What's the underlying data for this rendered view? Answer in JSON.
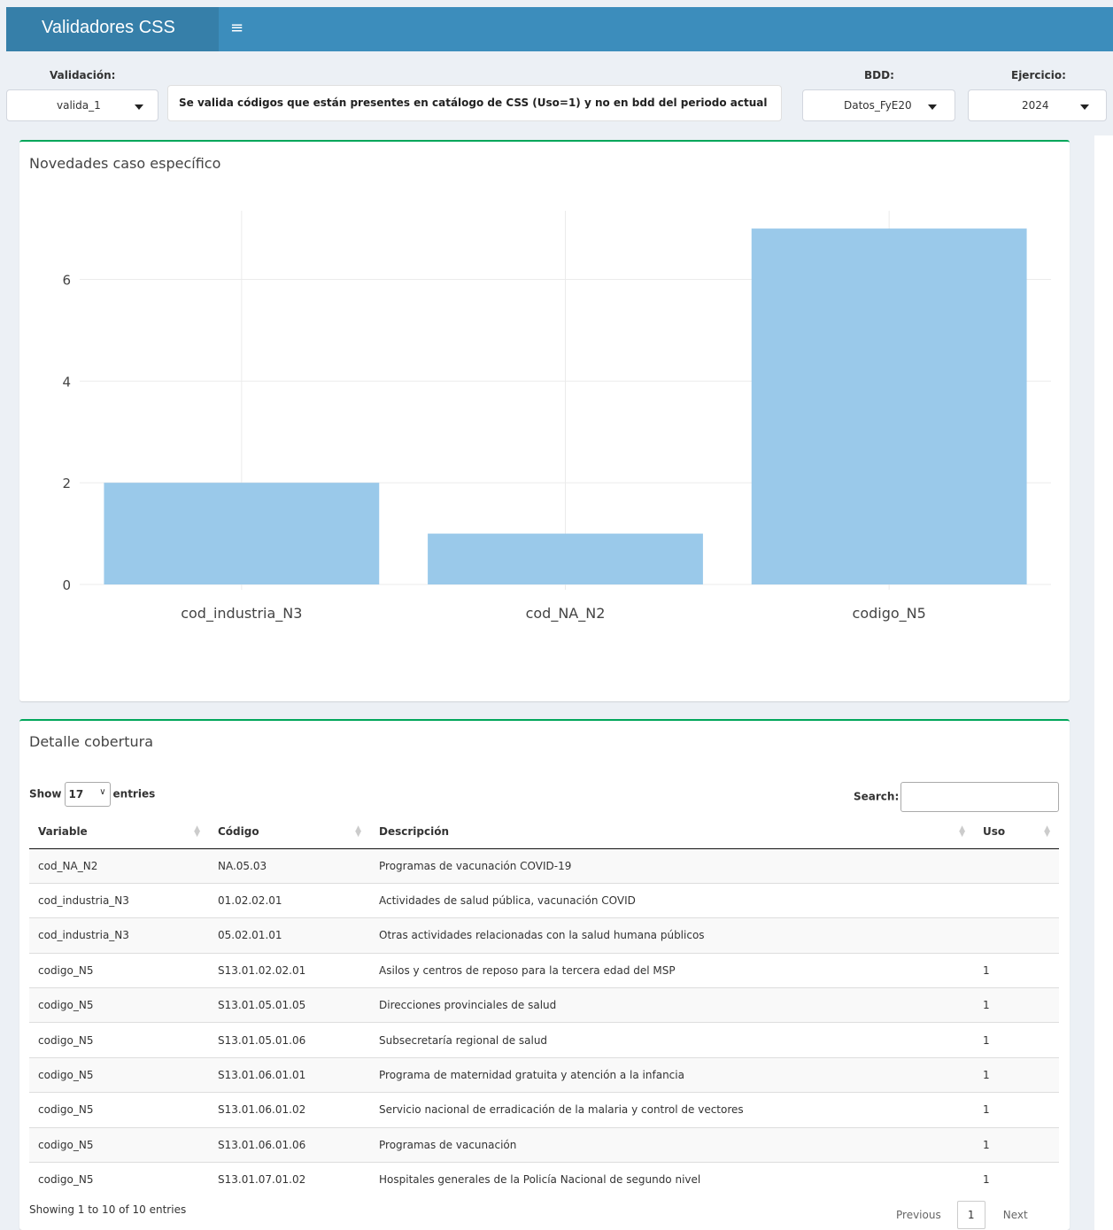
{
  "app": {
    "title": "Validadores CSS"
  },
  "controls": {
    "validacion_label": "Validación:",
    "validacion_value": "valida_1",
    "description": "Se valida códigos que están presentes en catálogo de CSS (Uso=1) y no en bdd del periodo actual",
    "bdd_label": "BDD:",
    "bdd_value": "Datos_FyE20",
    "ejercicio_label": "Ejercicio:",
    "ejercicio_value": "2024"
  },
  "chart_box": {
    "title": "Novedades caso específico"
  },
  "chart_data": {
    "type": "bar",
    "categories": [
      "cod_industria_N3",
      "cod_NA_N2",
      "codigo_N5"
    ],
    "values": [
      2,
      1,
      7
    ],
    "yticks": [
      0,
      2,
      4,
      6
    ],
    "ylim": [
      0,
      7.35
    ],
    "grid": true,
    "bar_color": "#9ac9ea"
  },
  "table_box": {
    "title": "Detalle cobertura",
    "show_label": "Show",
    "page_length": "17",
    "entries_label": "entries",
    "search_label": "Search:",
    "columns": [
      "Variable",
      "Código",
      "Descripción",
      "Uso"
    ],
    "rows": [
      [
        "cod_NA_N2",
        "NA.05.03",
        "Programas de vacunación COVID-19",
        ""
      ],
      [
        "cod_industria_N3",
        "01.02.02.01",
        "Actividades de salud pública, vacunación COVID",
        ""
      ],
      [
        "cod_industria_N3",
        "05.02.01.01",
        "Otras actividades relacionadas con la salud humana públicos",
        ""
      ],
      [
        "codigo_N5",
        "S13.01.02.02.01",
        "Asilos y centros de reposo para la tercera edad del MSP",
        "1"
      ],
      [
        "codigo_N5",
        "S13.01.05.01.05",
        "Direcciones provinciales de salud",
        "1"
      ],
      [
        "codigo_N5",
        "S13.01.05.01.06",
        "Subsecretaría regional de salud",
        "1"
      ],
      [
        "codigo_N5",
        "S13.01.06.01.01",
        "Programa de maternidad gratuita y atención a la infancia",
        "1"
      ],
      [
        "codigo_N5",
        "S13.01.06.01.02",
        "Servicio nacional de erradicación de la malaria y control de vectores",
        "1"
      ],
      [
        "codigo_N5",
        "S13.01.06.01.06",
        "Programas de vacunación",
        "1"
      ],
      [
        "codigo_N5",
        "S13.01.07.01.02",
        "Hospitales generales de la Policía Nacional de segundo nivel",
        "1"
      ]
    ],
    "info": "Showing 1 to 10 of 10 entries",
    "previous": "Previous",
    "current_page": "1",
    "next": "Next"
  }
}
